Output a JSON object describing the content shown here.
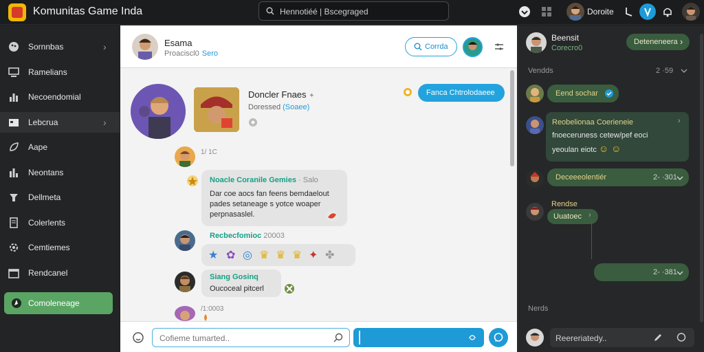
{
  "app": {
    "title": "Komunitas Game Inda"
  },
  "search": {
    "value": "Hennotiéé | Bscegraged"
  },
  "topbar": {
    "user_name": "Doroite"
  },
  "sidebar": {
    "items": [
      {
        "label": "Sornnbas",
        "icon": "palette-icon",
        "chevron": "›"
      },
      {
        "label": "Ramelians",
        "icon": "screen-icon"
      },
      {
        "label": "Necoendomial",
        "icon": "chart-bars-icon"
      },
      {
        "label": "Lebcrua",
        "icon": "folder-icon",
        "chevron": "›",
        "active": true
      },
      {
        "label": "Aape",
        "icon": "leaf-icon"
      },
      {
        "label": "Neontans",
        "icon": "chart-bars-icon"
      },
      {
        "label": "Dellmeta",
        "icon": "pin-icon"
      },
      {
        "label": "Colerlents",
        "icon": "document-icon"
      },
      {
        "label": "Cemtiemes",
        "icon": "gear-icon"
      },
      {
        "label": "Rendcanel",
        "icon": "calendar-icon"
      }
    ],
    "cta": {
      "label": "Comoleneage",
      "icon": "compass-icon"
    }
  },
  "chat": {
    "header": {
      "name": "Esama",
      "status": "Proaciscl0",
      "status_extra": "Sero",
      "button": "Corrda"
    },
    "group_card": {
      "title": "Doncler Fnaes",
      "subtitle": "Doressed",
      "subtitle_extra": "(Soaee)"
    },
    "outgoing": {
      "text": "Fanca Chtrolodaeee"
    },
    "messages": [
      {
        "time": "1/ 1C"
      },
      {
        "author": "Noacle Coranile Gemies",
        "meta": "· Salo",
        "lines": [
          "Dar coe aocs fan feens bemdaelout",
          "pades setaneage s yotce woaper",
          "perpnasaslel."
        ]
      },
      {
        "author": "Recbecfomioc",
        "meta": "20003",
        "emoji": [
          "★",
          "✿",
          "◎",
          "♛",
          "♛",
          "♛",
          "✦",
          "✤"
        ]
      },
      {
        "author": "Siang Gosinq",
        "text": "Oucoceal pitcerl"
      },
      {
        "time": "/1:0003"
      }
    ],
    "composer": {
      "placeholder": "Cofieme tumarted.."
    }
  },
  "right": {
    "header": {
      "name": "Beensit",
      "sub": "Corecro0",
      "button": "Deteneneera"
    },
    "section1": {
      "label": "Vendds",
      "count": "2 ·59"
    },
    "messages": [
      {
        "text": "Eend sochar"
      },
      {
        "author": "Reobelionaa",
        "text_lines": [
          "Reobelionaa Coerieneie",
          "fnoeceruness cetew/pef eoci",
          "yeoulan eiotc"
        ]
      },
      {
        "text": "Deceeeolentiér",
        "time": "2- ·301"
      },
      {
        "author": "Rendse",
        "text": "Uuatoec"
      },
      {
        "time": "2- ·381"
      }
    ],
    "section2": {
      "label": "Nerds"
    },
    "composer": {
      "placeholder": "Reereriatedy.."
    }
  },
  "colors": {
    "accent": "#1e9bd7",
    "green": "#5aa564",
    "teal": "#17a085"
  }
}
